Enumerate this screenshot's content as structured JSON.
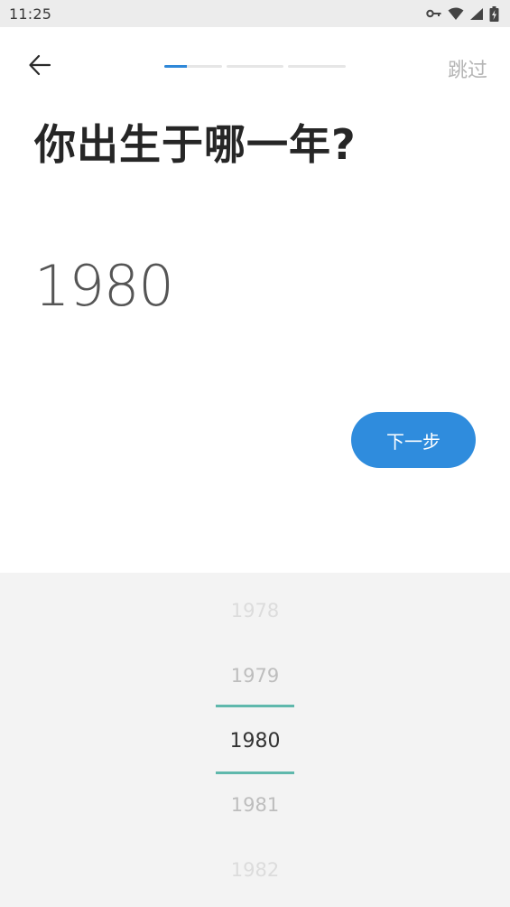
{
  "status_bar": {
    "time": "11:25",
    "icons": [
      "key-icon",
      "wifi-icon",
      "signal-icon",
      "battery-icon"
    ]
  },
  "header": {
    "back_icon": "arrow-left-icon",
    "progress": {
      "steps": 3,
      "current_step": 1,
      "current_fill": 0.4,
      "accent": "#2f88d8"
    },
    "skip_label": "跳过"
  },
  "question": {
    "title": "你出生于哪一年?"
  },
  "selected_year": "1980",
  "next_button": {
    "label": "下一步",
    "color": "#2f8cdd"
  },
  "picker": {
    "items": [
      "1978",
      "1979",
      "1980",
      "1981",
      "1982"
    ],
    "selected": "1980",
    "indicator_color": "#5fb8ac"
  }
}
